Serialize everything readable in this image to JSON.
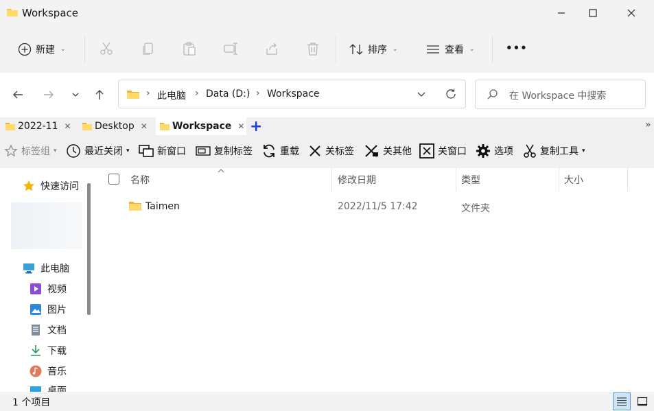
{
  "window": {
    "title": "Workspace"
  },
  "commands": {
    "new_label": "新建",
    "sort_label": "排序",
    "view_label": "查看",
    "more_label": "•••"
  },
  "address": {
    "crumbs": [
      "此电脑",
      "Data (D:)",
      "Workspace"
    ],
    "search_placeholder": "在 Workspace 中搜索"
  },
  "tabs": [
    {
      "label": "2022-11",
      "active": false
    },
    {
      "label": "Desktop",
      "active": false
    },
    {
      "label": "Workspace",
      "active": true
    }
  ],
  "toolbar": {
    "tab_group": "标签组",
    "recent_closed": "最近关闭",
    "new_window": "新窗口",
    "copy_tab": "复制标签",
    "reload": "重载",
    "close_tab": "关标签",
    "close_others": "关其他",
    "close_window": "关窗口",
    "options": "选项",
    "copy_tool": "复制工具",
    "overflow": "»"
  },
  "sidebar": {
    "items": [
      {
        "label": "快速访问",
        "icon": "star-icon"
      },
      {
        "label": "此电脑",
        "icon": "computer-icon"
      },
      {
        "label": "视频",
        "icon": "video-icon"
      },
      {
        "label": "图片",
        "icon": "picture-icon"
      },
      {
        "label": "文档",
        "icon": "document-icon"
      },
      {
        "label": "下载",
        "icon": "download-icon"
      },
      {
        "label": "音乐",
        "icon": "music-icon"
      },
      {
        "label": "桌面",
        "icon": "desktop-icon"
      }
    ]
  },
  "table": {
    "columns": [
      "名称",
      "修改日期",
      "类型",
      "大小"
    ],
    "rows": [
      {
        "name": "Taimen",
        "modified": "2022/11/5 17:42",
        "type": "文件夹",
        "size": ""
      }
    ]
  },
  "status": {
    "count": "1 个项目"
  },
  "colors": {
    "accent": "#0067c0",
    "folder": "#f4c542",
    "tab_plus": "#1f3fd6"
  }
}
